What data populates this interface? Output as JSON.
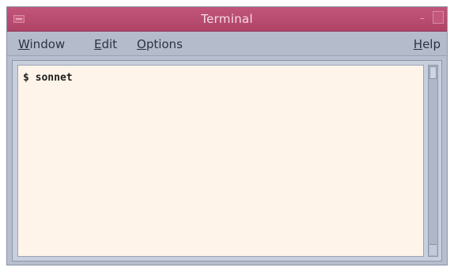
{
  "window": {
    "title": "Terminal"
  },
  "menubar": {
    "window": {
      "mnemonic": "W",
      "rest": "indow"
    },
    "edit": {
      "mnemonic": "E",
      "rest": "dit"
    },
    "options": {
      "mnemonic": "O",
      "rest": "ptions"
    },
    "help": {
      "mnemonic": "H",
      "rest": "elp"
    }
  },
  "terminal": {
    "lines": [
      "$ sonnet"
    ]
  },
  "colors": {
    "titlebar": "#b04467",
    "terminal_bg": "#fff4ea",
    "chrome": "#b7bfcf"
  }
}
